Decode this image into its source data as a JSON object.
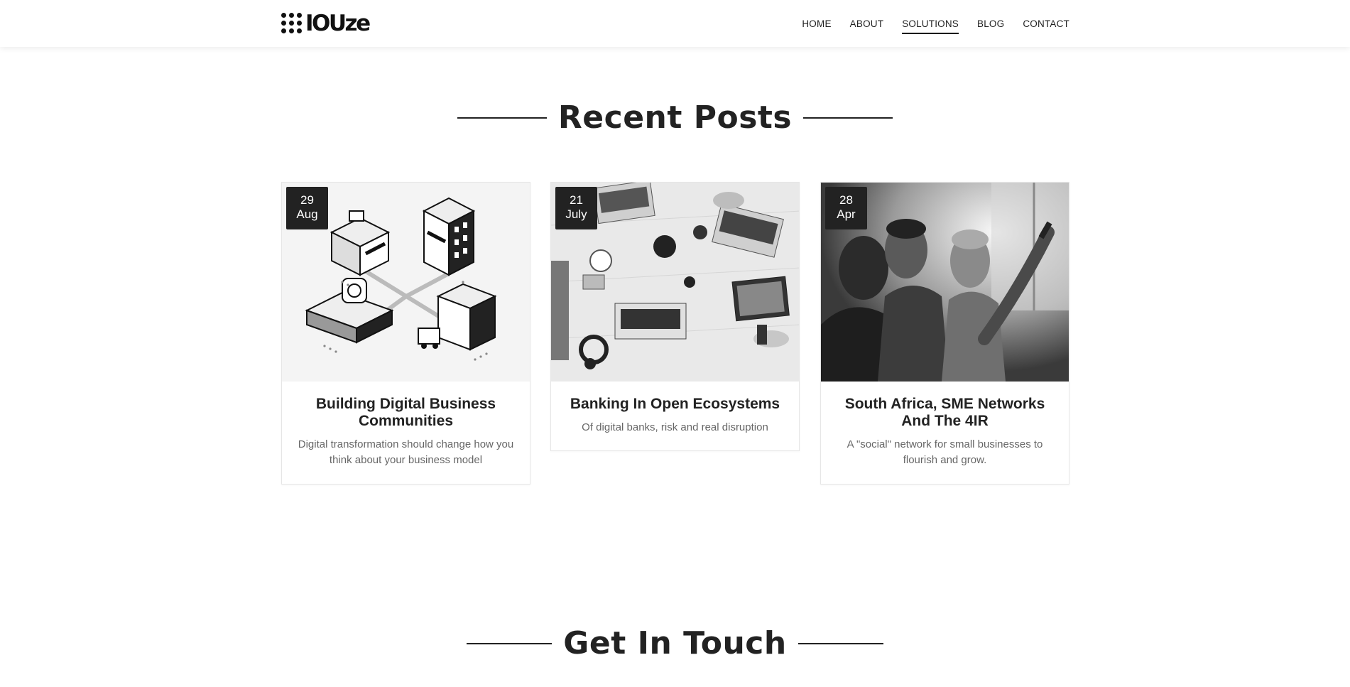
{
  "header": {
    "logo_text": "IOUze",
    "nav": [
      {
        "label": "HOME",
        "active": false
      },
      {
        "label": "ABOUT",
        "active": false
      },
      {
        "label": "SOLUTIONS",
        "active": true
      },
      {
        "label": "BLOG",
        "active": false
      },
      {
        "label": "CONTACT",
        "active": false
      }
    ]
  },
  "recent_posts": {
    "title": "Recent Posts",
    "posts": [
      {
        "day": "29",
        "month": "Aug",
        "title": "Building Digital Business Communities",
        "description": "Digital transformation should change how you think about your business model",
        "image": "isometric-buildings-illustration"
      },
      {
        "day": "21",
        "month": "July",
        "title": "Banking In Open Ecosystems",
        "description": "Of digital banks, risk and real disruption",
        "image": "desk-with-laptops-photo"
      },
      {
        "day": "28",
        "month": "Apr",
        "title": "South Africa, SME Networks And The 4IR",
        "description": "A \"social\" network for small businesses to flourish and grow.",
        "image": "team-at-whiteboard-photo"
      }
    ]
  },
  "get_in_touch": {
    "title": "Get In Touch"
  },
  "colors": {
    "text": "#222222",
    "badge_bg": "#222222",
    "muted_text": "#666666",
    "card_border": "#e6e6e6"
  }
}
